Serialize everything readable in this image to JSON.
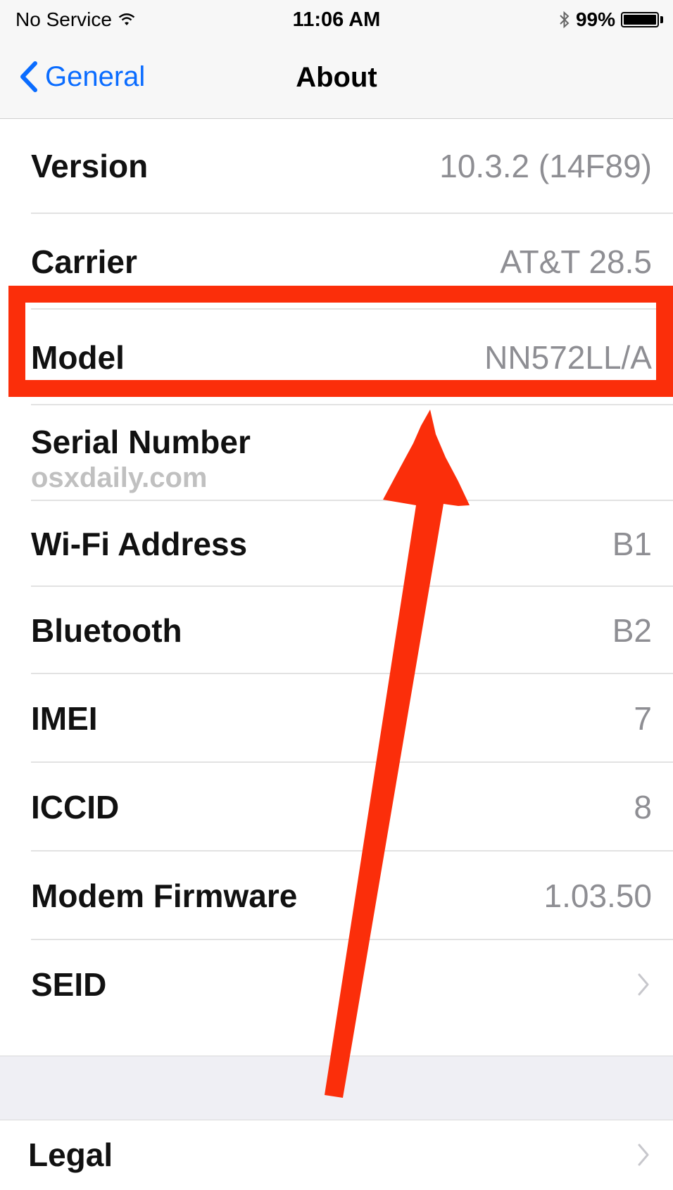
{
  "status_bar": {
    "carrier": "No Service",
    "time": "11:06 AM",
    "battery_percent": "99%",
    "battery_level": 0.99,
    "icons": [
      "wifi-icon",
      "bluetooth-icon",
      "battery-icon"
    ]
  },
  "nav": {
    "back_label": "General",
    "title": "About"
  },
  "rows": [
    {
      "label": "Version",
      "value": "10.3.2 (14F89)"
    },
    {
      "label": "Carrier",
      "value": "AT&T 28.5"
    },
    {
      "label": "Model",
      "value": "NN572LL/A"
    },
    {
      "label": "Serial Number",
      "value": ""
    },
    {
      "label": "Wi-Fi Address",
      "value": "B1"
    },
    {
      "label": "Bluetooth",
      "value": "B2"
    },
    {
      "label": "IMEI",
      "value": "7"
    },
    {
      "label": "ICCID",
      "value": "8"
    },
    {
      "label": "Modem Firmware",
      "value": "1.03.50"
    },
    {
      "label": "SEID",
      "value": ""
    }
  ],
  "legal": {
    "label": "Legal"
  },
  "watermark": "osxdaily.com",
  "colors": {
    "accent": "#0a6cff",
    "annotation": "#fb2e0a",
    "value_text": "#8e8e93"
  }
}
